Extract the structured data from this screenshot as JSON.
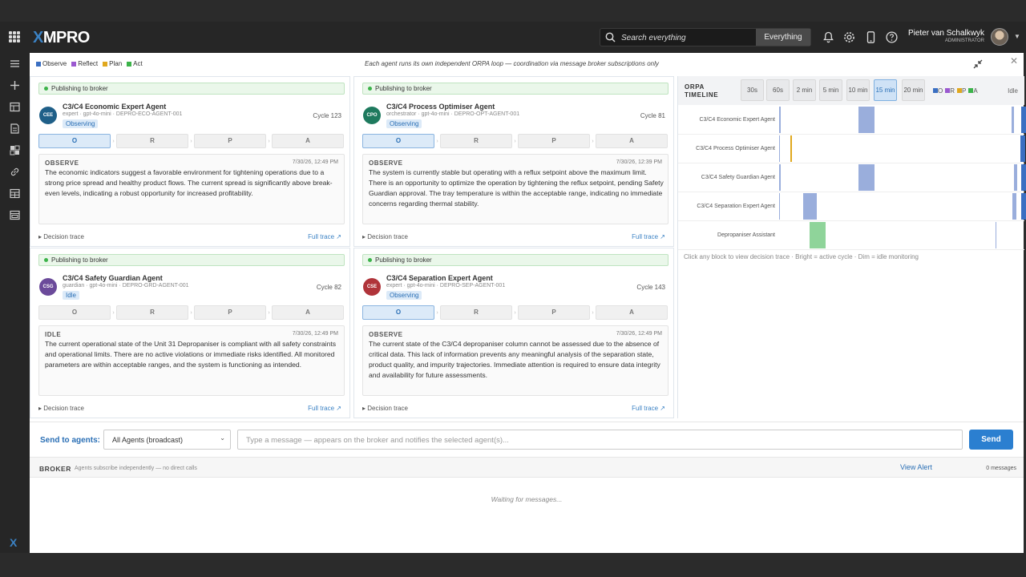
{
  "header": {
    "logo": "XMPRO",
    "search": {
      "placeholder": "Search everything",
      "scope": "Everything"
    },
    "user": {
      "name": "Pieter van Schalkwyk",
      "role": "ADMINISTRATOR"
    }
  },
  "toolbar": {
    "legend": [
      {
        "label": "Observe",
        "color": "#3b6fc2"
      },
      {
        "label": "Reflect",
        "color": "#9b59d0"
      },
      {
        "label": "Plan",
        "color": "#e0a81e"
      },
      {
        "label": "Act",
        "color": "#3cb34a"
      }
    ],
    "note": "Each agent runs its own independent ORPA loop — coordination via message broker subscriptions only"
  },
  "phases": [
    "O",
    "R",
    "P",
    "A"
  ],
  "agents": [
    {
      "publish": "Publishing to broker",
      "initials": "CEE",
      "badge_color": "#1f5f88",
      "name": "C3/C4 Economic Expert Agent",
      "meta": "expert · gpt-4o-mini · DEPRO-ECO-AGENT-001",
      "state": "Observing",
      "cycle": "Cycle 123",
      "phase_label": "OBSERVE",
      "time": "7/30/26, 12:49 PM",
      "text": "The economic indicators suggest a favorable environment for tightening operations due to a strong price spread and healthy product flows. The current spread is significantly above break-even levels, indicating a robust opportunity for increased profitability.",
      "decision": "Decision trace",
      "full": "Full trace ↗",
      "active_phase": "O"
    },
    {
      "publish": "Publishing to broker",
      "initials": "CPO",
      "badge_color": "#1e7a5e",
      "name": "C3/C4 Process Optimiser Agent",
      "meta": "orchestrator · gpt-4o-mini · DEPRO-OPT-AGENT-001",
      "state": "Observing",
      "cycle": "Cycle 81",
      "phase_label": "OBSERVE",
      "time": "7/30/26, 12:39 PM",
      "text": "The system is currently stable but operating with a reflux setpoint above the maximum limit. There is an opportunity to optimize the operation by tightening the reflux setpoint, pending Safety Guardian approval. The tray temperature is within the acceptable range, indicating no immediate concerns regarding thermal stability.",
      "decision": "Decision trace",
      "full": "Full trace ↗",
      "active_phase": "O"
    },
    {
      "publish": "Publishing to broker",
      "initials": "CSG",
      "badge_color": "#6b4a9a",
      "name": "C3/C4 Safety Guardian Agent",
      "meta": "guardian · gpt-4o-mini · DEPRO-GRD-AGENT-001",
      "state": "Idle",
      "cycle": "Cycle 82",
      "phase_label": "IDLE",
      "time": "7/30/26, 12:49 PM",
      "text": "The current operational state of the Unit 31 Depropaniser is compliant with all safety constraints and operational limits. There are no active violations or immediate risks identified. All monitored parameters are within acceptable ranges, and the system is functioning as intended.",
      "decision": "Decision trace",
      "full": "Full trace ↗",
      "active_phase": ""
    },
    {
      "publish": "Publishing to broker",
      "initials": "CSE",
      "badge_color": "#b0343a",
      "name": "C3/C4 Separation Expert Agent",
      "meta": "expert · gpt-4o-mini · DEPRO-SEP-AGENT-001",
      "state": "Observing",
      "cycle": "Cycle 143",
      "phase_label": "OBSERVE",
      "time": "7/30/26, 12:49 PM",
      "text": "The current state of the C3/C4 depropaniser column cannot be assessed due to the absence of critical data. This lack of information prevents any meaningful analysis of the separation state, product quality, and impurity trajectories. Immediate attention is required to ensure data integrity and availability for future assessments.",
      "decision": "Decision trace",
      "full": "Full trace ↗",
      "active_phase": "O"
    }
  ],
  "timeline": {
    "title": "ORPA TIMELINE",
    "ranges": [
      {
        "label": "30s",
        "active": false
      },
      {
        "label": "60s",
        "active": false
      },
      {
        "label": "2 min",
        "active": false
      },
      {
        "label": "5 min",
        "active": false
      },
      {
        "label": "10 min",
        "active": false
      },
      {
        "label": "15 min",
        "active": true
      },
      {
        "label": "20 min",
        "active": false
      }
    ],
    "legend": [
      "O",
      "R",
      "P",
      "A"
    ],
    "idle_label": "Idle",
    "rows": [
      {
        "label": "C3/C4 Economic Expert Agent"
      },
      {
        "label": "C3/C4 Process Optimiser Agent"
      },
      {
        "label": "C3/C4 Safety Guardian Agent"
      },
      {
        "label": "C3/C4 Separation Expert Agent"
      },
      {
        "label": "Depropaniser Assistant"
      }
    ],
    "footer": "Click any block to view decision trace · Bright = active cycle · Dim = idle monitoring"
  },
  "composer": {
    "label": "Send to agents:",
    "target": "All Agents (broadcast)",
    "placeholder": "Type a message — appears on the broker and notifies the selected agent(s)...",
    "send": "Send"
  },
  "broker": {
    "title": "BROKER",
    "subtitle": "Agents subscribe independently — no direct calls",
    "view_alert": "View Alert",
    "count": "0 messages",
    "waiting": "Waiting for messages..."
  }
}
